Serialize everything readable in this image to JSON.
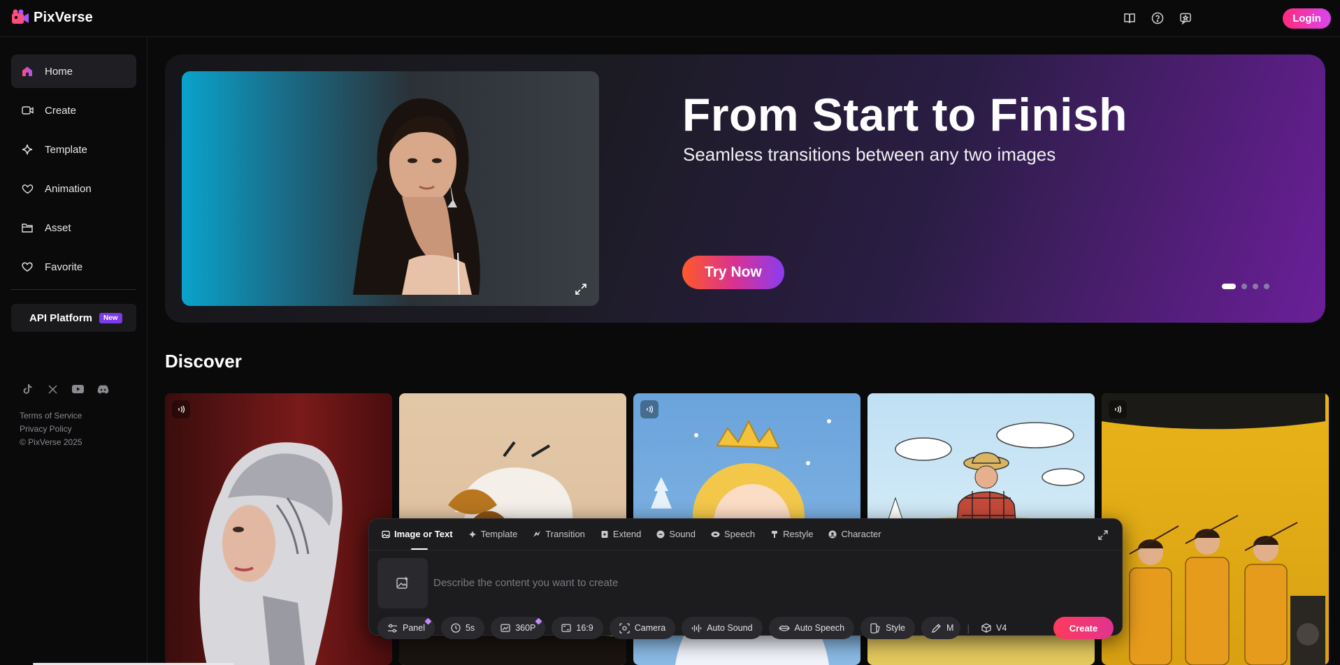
{
  "header": {
    "app_name": "PixVerse",
    "login_label": "Login",
    "icons": [
      "book-icon",
      "help-icon",
      "feedback-icon"
    ],
    "accent": "#e0347a"
  },
  "sidebar": {
    "items": [
      {
        "label": "Home",
        "icon": "home-icon",
        "active": true
      },
      {
        "label": "Create",
        "icon": "video-icon",
        "active": false
      },
      {
        "label": "Template",
        "icon": "sparkle-icon",
        "active": false
      },
      {
        "label": "Animation",
        "icon": "heart-hands-icon",
        "active": false
      },
      {
        "label": "Asset",
        "icon": "folder-icon",
        "active": false
      },
      {
        "label": "Favorite",
        "icon": "heart-icon",
        "active": false
      }
    ],
    "api_label": "API Platform",
    "api_badge": "New",
    "socials": [
      "tiktok-icon",
      "x-icon",
      "youtube-icon",
      "discord-icon"
    ],
    "footer": {
      "terms": "Terms of Service",
      "privacy": "Privacy Policy",
      "copyright": "© PixVerse 2025"
    }
  },
  "hero": {
    "title": "From Start to Finish",
    "subtitle": "Seamless transitions between any two images",
    "cta": "Try Now",
    "slide_count": 4,
    "active_slide": 1
  },
  "discover": {
    "title": "Discover"
  },
  "composer": {
    "tabs": [
      {
        "label": "Image or Text",
        "icon": "image-icon",
        "active": true
      },
      {
        "label": "Template",
        "icon": "sparkle-icon",
        "active": false
      },
      {
        "label": "Transition",
        "icon": "transition-icon",
        "active": false
      },
      {
        "label": "Extend",
        "icon": "extend-icon",
        "active": false
      },
      {
        "label": "Sound",
        "icon": "sound-icon",
        "active": false
      },
      {
        "label": "Speech",
        "icon": "speech-icon",
        "active": false
      },
      {
        "label": "Restyle",
        "icon": "restyle-icon",
        "active": false
      },
      {
        "label": "Character",
        "icon": "character-icon",
        "active": false
      }
    ],
    "placeholder": "Describe the content you want to create",
    "chips": {
      "panel": "Panel",
      "duration": "5s",
      "quality": "360P",
      "ratio": "16:9",
      "camera": "Camera",
      "auto_sound": "Auto Sound",
      "auto_speech": "Auto Speech",
      "style": "Style",
      "magic": "M",
      "model": "V4"
    },
    "create_label": "Create"
  }
}
